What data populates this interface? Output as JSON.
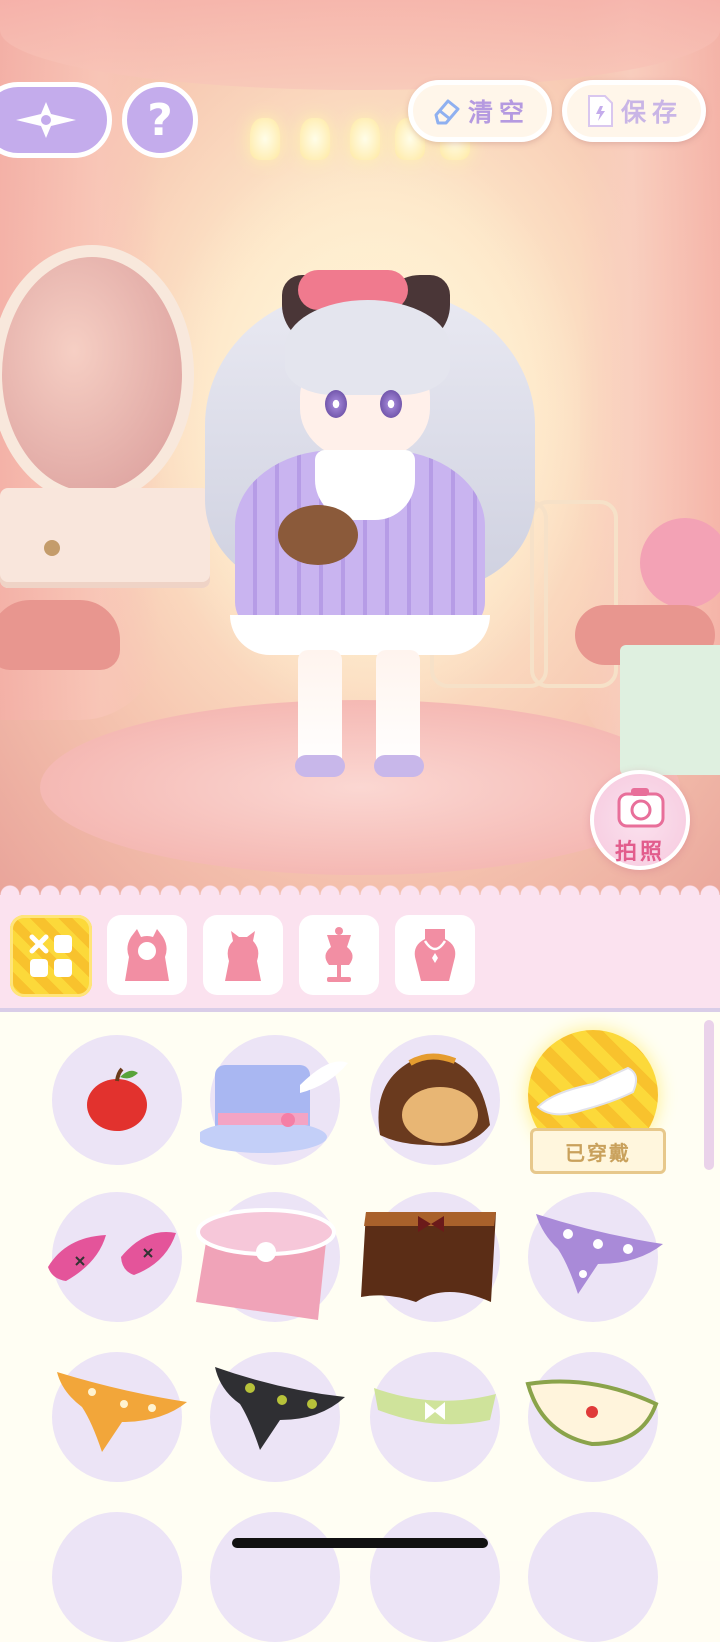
{
  "top_bar": {
    "back_icon": "compass-star-icon",
    "help_label": "?",
    "clear_label": "清空",
    "save_label": "保存"
  },
  "scene": {
    "photo_label": "拍照"
  },
  "tabs": [
    {
      "id": "all",
      "icon": "grid-all-icon",
      "active": true
    },
    {
      "id": "hood",
      "icon": "cat-hood-silhouette-icon",
      "active": false
    },
    {
      "id": "head",
      "icon": "head-bow-silhouette-icon",
      "active": false
    },
    {
      "id": "outfit",
      "icon": "mannequin-icon",
      "active": false
    },
    {
      "id": "necklace",
      "icon": "necklace-bust-icon",
      "active": false
    }
  ],
  "items": [
    {
      "name": "apple-item"
    },
    {
      "name": "top-hat-item"
    },
    {
      "name": "bread-hat-item"
    },
    {
      "name": "white-hair-clip-item",
      "equipped": true,
      "badge": "已穿戴"
    },
    {
      "name": "pink-horns-item"
    },
    {
      "name": "pink-bag-item"
    },
    {
      "name": "brown-cloth-item"
    },
    {
      "name": "purple-dotted-bandana-item"
    },
    {
      "name": "orange-dotted-bandana-item"
    },
    {
      "name": "black-dotted-bandana-item"
    },
    {
      "name": "green-check-headband-item"
    },
    {
      "name": "cream-strawberry-bib-item"
    }
  ],
  "colors": {
    "accent_purple": "#c4acec",
    "equipped_yellow": "#fcd93a",
    "tab_bg_pink": "#fbe2ef",
    "photo_text_pink": "#e25c8c"
  }
}
